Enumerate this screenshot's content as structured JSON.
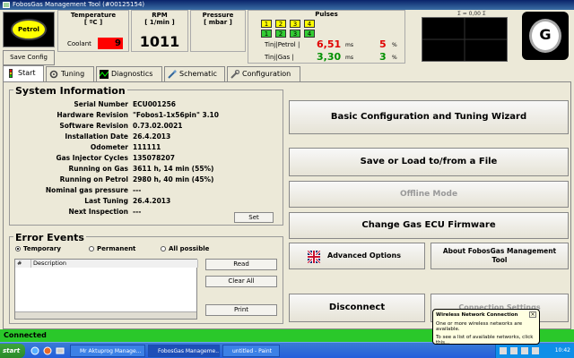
{
  "window": {
    "title": "FobosGas Management Tool (#00125154)"
  },
  "top": {
    "petrol_label": "Petrol",
    "save_config": "Save Config",
    "temperature_header": "Temperature",
    "temperature_unit": "[ ºC ]",
    "coolant_label": "Coolant",
    "coolant_value": "9",
    "rpm_header": "RPM",
    "rpm_unit": "[ 1/min ]",
    "rpm_value": "1011",
    "pressure_header": "Pressure",
    "pressure_unit": "[ mbar ]",
    "pulses_header": "Pulses",
    "pulse_cells_row1": [
      "1",
      "2",
      "3",
      "4"
    ],
    "pulse_cells_row2": [
      "1",
      "2",
      "3",
      "4"
    ],
    "tinj_petrol_label": "Tinj|Petrol |",
    "tinj_petrol_value": "6,51",
    "tinj_petrol_pct": "5",
    "tinj_gas_label": "Tinj|Gas |",
    "tinj_gas_value": "3,30",
    "tinj_gas_pct": "3",
    "ms_unit": "ms",
    "pct_unit": "%",
    "scope_label": "Σ = 0,00 Σ"
  },
  "tabs": [
    {
      "label": "Start",
      "icon": "traffic-light-icon"
    },
    {
      "label": "Tuning",
      "icon": "gear-icon"
    },
    {
      "label": "Diagnostics",
      "icon": "oscilloscope-icon"
    },
    {
      "label": "Schematic",
      "icon": "schematic-icon"
    },
    {
      "label": "Configuration",
      "icon": "wrench-icon"
    }
  ],
  "system_info": {
    "title": "System Information",
    "rows": [
      {
        "k": "Serial Number",
        "v": "ECU001256"
      },
      {
        "k": "Hardware Revision",
        "v": "\"Fobos1-1x56pin\" 3.10"
      },
      {
        "k": "Software Revision",
        "v": "0.73.02.0021"
      },
      {
        "k": "Installation Date",
        "v": "26.4.2013"
      },
      {
        "k": "Odometer",
        "v": "111111"
      },
      {
        "k": "Gas Injector Cycles",
        "v": "135078207"
      },
      {
        "k": "Running on Gas",
        "v": "3611 h, 14 min (55%)"
      },
      {
        "k": "Running on Petrol",
        "v": "2980 h, 40 min (45%)"
      },
      {
        "k": "Nominal gas pressure",
        "v": "---"
      },
      {
        "k": "Last Tuning",
        "v": "26.4.2013"
      },
      {
        "k": "Next Inspection",
        "v": "---"
      }
    ],
    "set_button": "Set"
  },
  "error_events": {
    "title": "Error Events",
    "radio_temporary": "Temporary",
    "radio_permanent": "Permanent",
    "radio_all": "All possible",
    "col_num": "#",
    "col_desc": "Description",
    "read_button": "Read",
    "clear_button": "Clear All",
    "print_button": "Print"
  },
  "actions": {
    "wizard": "Basic Configuration and Tuning Wizard",
    "save_load": "Save or Load to/from a File",
    "offline": "Offline Mode",
    "firmware": "Change Gas ECU Firmware",
    "advanced": "Advanced Options",
    "about": "About FobosGas Management Tool",
    "disconnect": "Disconnect",
    "connection_settings": "Connection Settings"
  },
  "status": {
    "text": "Connected"
  },
  "taskbar": {
    "start": "start",
    "items": [
      "Mr Aktuprog Manage...",
      "FobosGas Manageme...",
      "untitled - Paint"
    ],
    "clock": "10:42"
  },
  "balloon": {
    "title": "Wireless Network Connection",
    "line1": "One or more wireless networks are available.",
    "line2": "To see a list of available networks, click this..."
  },
  "colors": {
    "petrol": "#ffff00",
    "coolant_alarm": "#ff0000",
    "status_ok": "#2ac82a",
    "pulse_yellow": "#ffff00",
    "pulse_green": "#33cc33"
  }
}
